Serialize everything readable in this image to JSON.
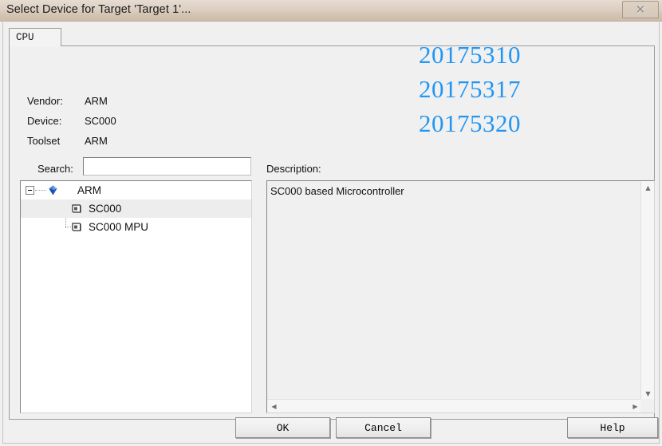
{
  "window": {
    "title": "Select Device for Target 'Target 1'...",
    "close_label": "✕",
    "close_icon": "close-icon"
  },
  "tabs": [
    {
      "label": "CPU",
      "selected": true
    }
  ],
  "info": {
    "vendor_label": "Vendor:",
    "vendor_value": "ARM",
    "device_label": "Device:",
    "device_value": "SC000",
    "toolset_label": "Toolset",
    "toolset_value": "ARM"
  },
  "search": {
    "label": "Search:",
    "value": "",
    "placeholder": ""
  },
  "tree": {
    "root": {
      "label": "ARM",
      "icon": "gem-icon",
      "expanded": true
    },
    "children": [
      {
        "label": "SC000",
        "icon": "chip-icon",
        "selected": true
      },
      {
        "label": "SC000 MPU",
        "icon": "chip-icon",
        "selected": false
      }
    ]
  },
  "description": {
    "label": "Description:",
    "text": "SC000 based Microcontroller",
    "scroll_up_icon": "▲",
    "scroll_down_icon": "▼",
    "scroll_left_icon": "◀",
    "scroll_right_icon": "▶"
  },
  "buttons": {
    "ok": "OK",
    "cancel": "Cancel",
    "help": "Help"
  },
  "overlay": {
    "numbers": [
      "20175310",
      "20175317",
      "20175320"
    ],
    "color": "#2196f3"
  },
  "colors": {
    "titlebar_start": "#e6dcd2",
    "titlebar_end": "#cdbca9",
    "dialog_bg": "#f0f0f0",
    "selection": "#ededed",
    "accent_blue": "#2196f3"
  }
}
